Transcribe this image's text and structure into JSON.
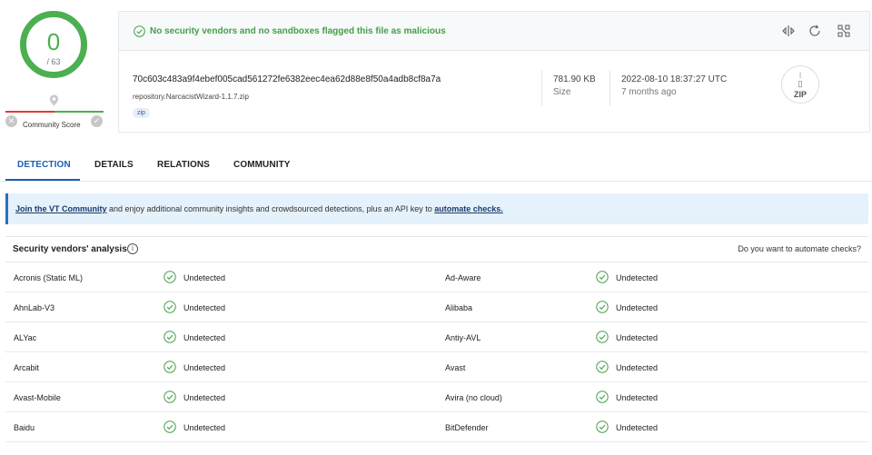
{
  "score": {
    "detections": "0",
    "total": "/ 63",
    "community_label": "Community Score"
  },
  "header": {
    "verdict": "No security vendors and no sandboxes flagged this file as malicious",
    "hash": "70c603c483a9f4ebef005cad561272fe6382eec4ea62d88e8f50a4adb8cf8a7a",
    "filename": "repository.NarcacistWizard-1.1.7.zip",
    "tag": "zip",
    "size_value": "781.90 KB",
    "size_label": "Size",
    "date_value": "2022-08-10 18:37:27 UTC",
    "date_label": "7 months ago",
    "file_type": "ZIP"
  },
  "tabs": [
    {
      "label": "DETECTION"
    },
    {
      "label": "DETAILS"
    },
    {
      "label": "RELATIONS"
    },
    {
      "label": "COMMUNITY"
    }
  ],
  "banner": {
    "link1": "Join the VT Community",
    "middle": " and enjoy additional community insights and crowdsourced detections, plus an API key to ",
    "link2": "automate checks."
  },
  "analysis": {
    "title": "Security vendors' analysis",
    "right_text": "Do you want to automate checks?",
    "rows": [
      {
        "left_vendor": "Acronis (Static ML)",
        "left_status": "Undetected",
        "right_vendor": "Ad-Aware",
        "right_status": "Undetected"
      },
      {
        "left_vendor": "AhnLab-V3",
        "left_status": "Undetected",
        "right_vendor": "Alibaba",
        "right_status": "Undetected"
      },
      {
        "left_vendor": "ALYac",
        "left_status": "Undetected",
        "right_vendor": "Antiy-AVL",
        "right_status": "Undetected"
      },
      {
        "left_vendor": "Arcabit",
        "left_status": "Undetected",
        "right_vendor": "Avast",
        "right_status": "Undetected"
      },
      {
        "left_vendor": "Avast-Mobile",
        "left_status": "Undetected",
        "right_vendor": "Avira (no cloud)",
        "right_status": "Undetected"
      },
      {
        "left_vendor": "Baidu",
        "left_status": "Undetected",
        "right_vendor": "BitDefender",
        "right_status": "Undetected"
      }
    ]
  },
  "colors": {
    "clean": "#4caf50",
    "accent": "#1a5fb4",
    "banner_bg": "#e5f1fb"
  }
}
